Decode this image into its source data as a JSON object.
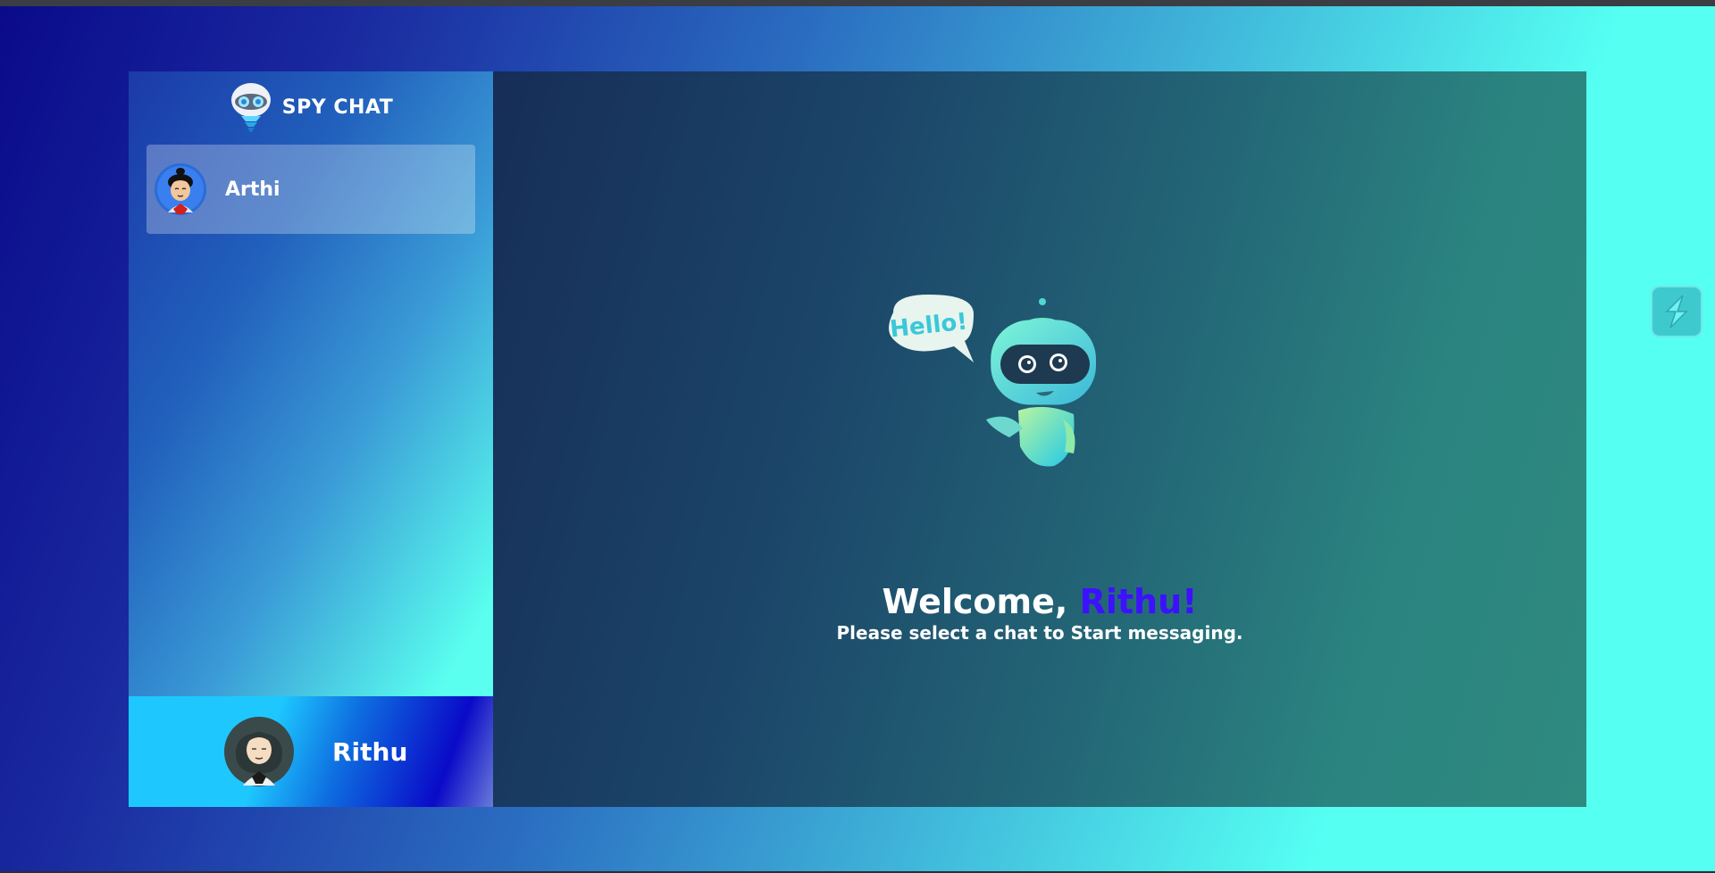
{
  "brand": {
    "name": "SPY CHAT"
  },
  "contacts": [
    {
      "name": "Arthi"
    }
  ],
  "current_user": {
    "name": "Rithu"
  },
  "welcome": {
    "prefix": "Welcome,",
    "name": "Rithu!",
    "subtitle": "Please select a chat to Start messaging.",
    "bubble_text": "Hello!"
  },
  "colors": {
    "highlight_name": "#3d10ff",
    "sidebar_accent": "#5affef",
    "main_background": "#1b4468"
  },
  "icons": {
    "brand": "robot-logo-icon",
    "extension": "extension-s-icon"
  }
}
